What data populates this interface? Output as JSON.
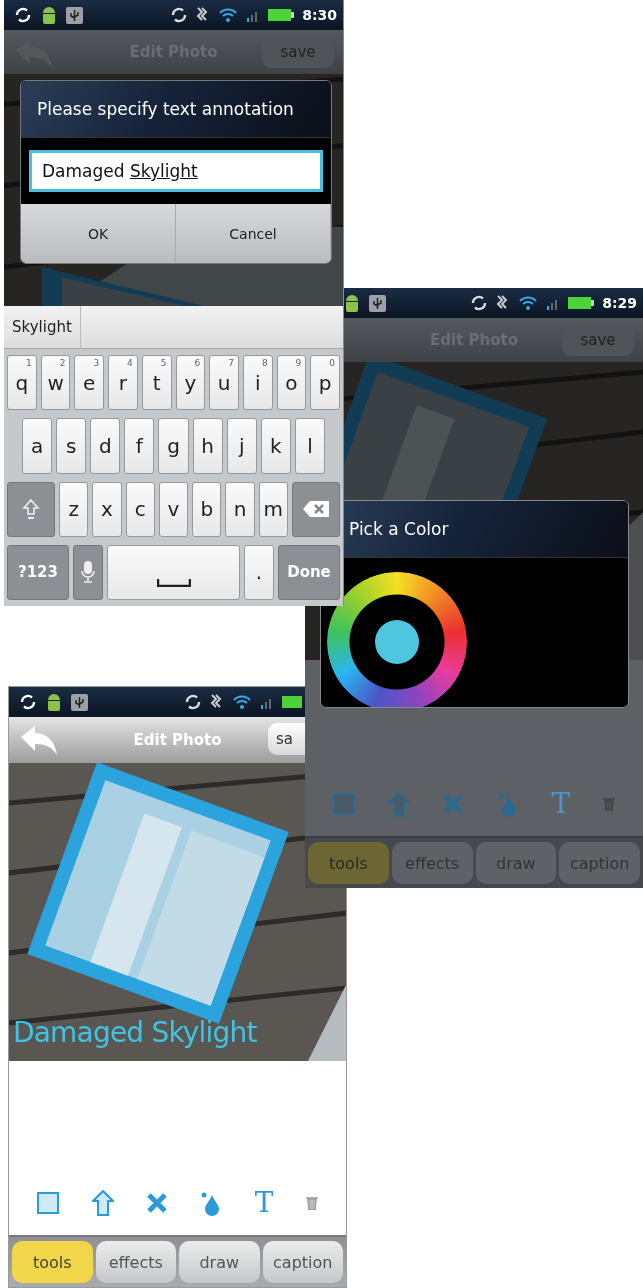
{
  "text_entry_screen": {
    "status_bar": {
      "time": "8:30"
    },
    "title": "Edit Photo",
    "save_button": "save",
    "dialog": {
      "title": "Please specify text annotation",
      "value": "Damaged",
      "composing": "Skylight",
      "buttons": [
        {
          "label": "OK"
        },
        {
          "label": "Cancel"
        }
      ]
    },
    "keyboard": {
      "suggestion": "Skylight",
      "row_1": [
        {
          "kind": "letter",
          "label": "q",
          "hint": "1"
        },
        {
          "kind": "letter",
          "label": "w",
          "hint": "2"
        },
        {
          "kind": "letter",
          "label": "e",
          "hint": "3"
        },
        {
          "kind": "letter",
          "label": "r",
          "hint": "4"
        },
        {
          "kind": "letter",
          "label": "t",
          "hint": "5"
        },
        {
          "kind": "letter",
          "label": "y",
          "hint": "6"
        },
        {
          "kind": "letter",
          "label": "u",
          "hint": "7"
        },
        {
          "kind": "letter",
          "label": "i",
          "hint": "8"
        },
        {
          "kind": "letter",
          "label": "o",
          "hint": "9"
        },
        {
          "kind": "letter",
          "label": "p",
          "hint": "0"
        }
      ],
      "row_2": [
        {
          "kind": "letter",
          "label": "a"
        },
        {
          "kind": "letter",
          "label": "s"
        },
        {
          "kind": "letter",
          "label": "d"
        },
        {
          "kind": "letter",
          "label": "f"
        },
        {
          "kind": "letter",
          "label": "g"
        },
        {
          "kind": "letter",
          "label": "h"
        },
        {
          "kind": "letter",
          "label": "j"
        },
        {
          "kind": "letter",
          "label": "k"
        },
        {
          "kind": "letter",
          "label": "l"
        }
      ],
      "row_3": [
        {
          "kind": "shift"
        },
        {
          "kind": "letter",
          "label": "z"
        },
        {
          "kind": "letter",
          "label": "x"
        },
        {
          "kind": "letter",
          "label": "c"
        },
        {
          "kind": "letter",
          "label": "v"
        },
        {
          "kind": "letter",
          "label": "b"
        },
        {
          "kind": "letter",
          "label": "n"
        },
        {
          "kind": "letter",
          "label": "m"
        },
        {
          "kind": "backspace"
        }
      ],
      "row_4": [
        {
          "kind": "action",
          "label": "?123"
        },
        {
          "kind": "mic"
        },
        {
          "kind": "space"
        },
        {
          "kind": "letter",
          "label": "."
        },
        {
          "kind": "action",
          "label": "Done"
        }
      ]
    }
  },
  "color_screen": {
    "status_bar": {
      "time": "8:29"
    },
    "title": "Edit Photo",
    "save_button": "save",
    "dialog": {
      "title": "Pick a Color"
    },
    "tools": [
      {
        "kind": "rectangle"
      },
      {
        "kind": "arrow"
      },
      {
        "kind": "cross"
      },
      {
        "kind": "drop"
      },
      {
        "kind": "text",
        "label": "T"
      },
      {
        "kind": "trash"
      }
    ],
    "tabs": [
      {
        "label": "tools",
        "selected": true
      },
      {
        "label": "effects",
        "selected": false
      },
      {
        "label": "draw",
        "selected": false
      },
      {
        "label": "caption",
        "selected": false
      }
    ]
  },
  "result_screen": {
    "title": "Edit Photo",
    "save_button": "sa",
    "caption": "Damaged Skylight",
    "tools": [
      {
        "kind": "rectangle"
      },
      {
        "kind": "arrow"
      },
      {
        "kind": "cross"
      },
      {
        "kind": "drop"
      },
      {
        "kind": "text",
        "label": "T"
      },
      {
        "kind": "trash"
      }
    ],
    "tabs": [
      {
        "label": "tools",
        "selected": true
      },
      {
        "label": "effects",
        "selected": false
      },
      {
        "label": "draw",
        "selected": false
      },
      {
        "label": "caption",
        "selected": false
      }
    ]
  }
}
